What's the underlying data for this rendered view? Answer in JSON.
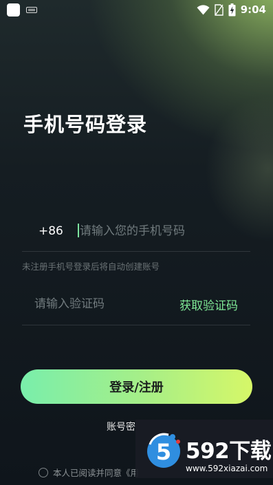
{
  "status_bar": {
    "time": "9:04",
    "icons": [
      "app-square-icon",
      "keyboard-icon",
      "wifi-icon",
      "no-sim-icon",
      "battery-charging-icon"
    ]
  },
  "login": {
    "title": "手机号码登录",
    "country_code": "+86",
    "phone_placeholder": "请输入您的手机号码",
    "hint": "未注册手机号登录后将自动创建账号",
    "code_placeholder": "请输入验证码",
    "get_code_label": "获取验证码",
    "submit_label": "登录/注册",
    "password_login_label": "账号密",
    "agreement_text": "本人已阅读并同意《用"
  },
  "watermark": {
    "logo_digit": "5",
    "brand": "592下载",
    "url": "www.592xiazai.com"
  },
  "colors": {
    "accent_green": "#7ee895",
    "button_gradient_start": "#79eeab",
    "button_gradient_end": "#d6f768"
  }
}
